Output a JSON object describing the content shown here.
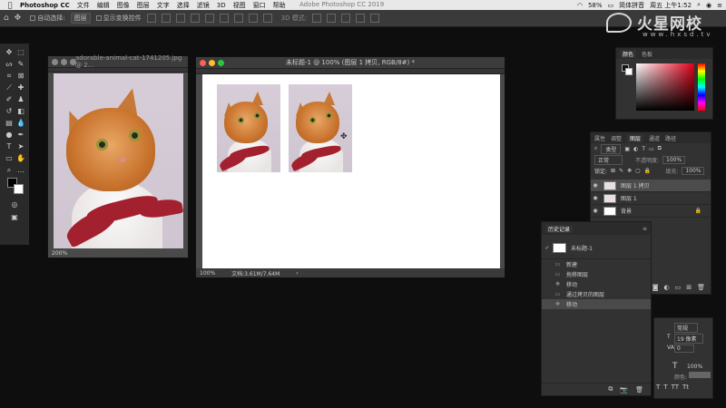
{
  "menubar": {
    "app_name": "Photoshop CC",
    "items": [
      "文件",
      "编辑",
      "图像",
      "图层",
      "文字",
      "选择",
      "滤镜",
      "3D",
      "视图",
      "窗口",
      "帮助"
    ],
    "window_title": "Adobe Photoshop CC 2019",
    "battery": "58%",
    "input_method": "简体拼音",
    "clock": "周五 上午1:52"
  },
  "options_bar": {
    "auto_select_label": "自动选择:",
    "auto_select_value": "图层",
    "show_transform_label": "显示变换控件",
    "mode_3d_label": "3D 模式:"
  },
  "watermark": {
    "brand": "火星网校",
    "url": "www.hxsd.tv"
  },
  "doc_left": {
    "title": "adorable-animal-cat-1741205.jpg @ 2...",
    "zoom": "200%"
  },
  "doc_main": {
    "title": "未标题-1 @ 100% (图层 1 拷贝, RGB/8#) *",
    "zoom": "100%",
    "doc_size": "文档:3.61M/7.64M"
  },
  "color_panel": {
    "tabs": [
      "颜色",
      "色板"
    ],
    "accent_hue": "#e0001a"
  },
  "layers_panel": {
    "tabs": [
      "属性",
      "调整",
      "图层",
      "通道",
      "路径"
    ],
    "active_tab": "图层",
    "filter_kind": "类型",
    "blend_mode": "正常",
    "opacity_label": "不透明度:",
    "opacity_value": "100%",
    "lock_label": "锁定:",
    "fill_label": "填充:",
    "fill_value": "100%",
    "layers": [
      {
        "name": "图层 1 拷贝",
        "selected": true
      },
      {
        "name": "图层 1",
        "selected": false
      },
      {
        "name": "背景",
        "selected": false
      }
    ]
  },
  "history_panel": {
    "title": "历史记录",
    "snapshot": "未标题-1",
    "steps": [
      "新建",
      "拖移图层",
      "移动",
      "通过拷贝的图层",
      "移动"
    ],
    "selected_index": 4
  },
  "char_panel": {
    "style": "常规",
    "size": "19 像素",
    "tracking": "0",
    "scale": "100%",
    "color_label": "颜色:"
  }
}
